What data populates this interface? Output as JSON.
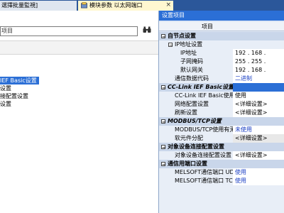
{
  "tabs": {
    "inactive_label": "選擇批量監視]",
    "active_label": "模块参数 以太网端口",
    "close_glyph": "×"
  },
  "left": {
    "search_text": "项目",
    "search_icon": "binoculars-icon",
    "tree": [
      "IEF Basic设置",
      "设置",
      "接配置设置",
      "设置"
    ]
  },
  "right": {
    "title": "设置项目",
    "col_header": "项目",
    "rows": [
      {
        "label": "自节点设置",
        "value": ""
      },
      {
        "label": "IP地址设置",
        "value": ""
      },
      {
        "label": "IP地址",
        "value": "192 . 168 ."
      },
      {
        "label": "子网掩码",
        "value": "255 . 255 ."
      },
      {
        "label": "默认网关",
        "value": "192 . 168 ."
      },
      {
        "label": "通信数据代码",
        "value": "二进制"
      },
      {
        "label": "CC-Link IEF Basic设置",
        "value": ""
      },
      {
        "label": "CC-Link IEF Basic使用有无",
        "value": "使用"
      },
      {
        "label": "网络配置设置",
        "value": "<详细设置>"
      },
      {
        "label": "刷新设置",
        "value": "<详细设置>"
      },
      {
        "label": "MODBUS/TCP设置",
        "value": ""
      },
      {
        "label": "MODBUS/TCP使用有无",
        "value": "未使用"
      },
      {
        "label": "软元件分配",
        "value": "<详细设置>"
      },
      {
        "label": "对象设备连接配置设置",
        "value": ""
      },
      {
        "label": "对象设备连接配置设置",
        "value": "<详细设置>"
      },
      {
        "label": "通信用端口设置",
        "value": ""
      },
      {
        "label": "MELSOFT通信端口 UDP/IP",
        "value": "使用"
      },
      {
        "label": "MELSOFT通信端口 TCP/IP",
        "value": "使用"
      }
    ]
  },
  "colors": {
    "accent": "#2b6fd6",
    "tab_bar": "#2b579a",
    "group_bg": "#c9d6ea",
    "value_blue": "#1a3fc4"
  }
}
